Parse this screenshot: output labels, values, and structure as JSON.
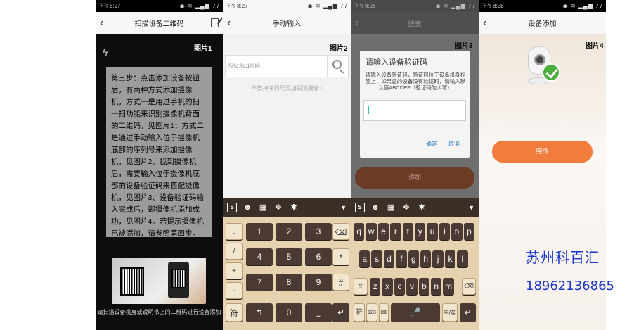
{
  "panel1": {
    "status_time": "下午8:27",
    "status_battery": "77",
    "title": "扫描设备二维码",
    "tag": "图片1",
    "step_text": "第三步：点击添加设备按钮后，有两种方式添加摄像机，方式一是用过手机的扫一扫功能来识别摄像机背面的二维码，见图片1；方式二是通过手动输入位于摄像机底部的序列号来添加摄像机，见图片2。找到摄像机后，需要输入位于摄像机底部的设备验证码来匹配摄像机，见图片3、设备验证码输入完成后，即摄像机添加成功，见图片4。若提示摄像机已被添加，请参照第四步。",
    "hint": "请扫描设备机身或说明书上的二维码进行设备添加"
  },
  "panel2": {
    "status_time": "下午8:27",
    "status_battery": "77",
    "title": "手动输入",
    "tag": "图片2",
    "serial_value": "584344899",
    "note": "不支持序列号添加探测摄像~"
  },
  "panel3": {
    "status_time": "下午8:28",
    "status_battery": "77",
    "title": "结果",
    "tag": "图片3",
    "dialog_title": "请输入设备验证码",
    "dialog_msg": "请输入设备验证码，验证码位于设备机身标签上，如果您的设备没有验证码，请输入默认值ABCDEF（验证码为大写）",
    "ok": "确定",
    "cancel": "取消",
    "add_button": "添加"
  },
  "panel4": {
    "status_time": "下午8:28",
    "status_battery": "77",
    "title": "设备添加",
    "tag": "图片4",
    "done_button": "完成"
  },
  "keyboard2": {
    "side": [
      ".",
      "/",
      "+",
      "-"
    ],
    "digits": [
      "1",
      "2",
      "3",
      "4",
      "5",
      "6",
      "7",
      "8",
      "9"
    ],
    "fn": [
      "⌫",
      "*",
      "#"
    ],
    "bottom": [
      "符",
      "0"
    ]
  },
  "keyboard3": {
    "row1": [
      "q",
      "w",
      "e",
      "r",
      "t",
      "y",
      "u",
      "i",
      "o",
      "p"
    ],
    "row2": [
      "a",
      "s",
      "d",
      "f",
      "g",
      "h",
      "j",
      "k",
      "l"
    ],
    "row3": [
      "z",
      "x",
      "c",
      "v",
      "b",
      "n",
      "m"
    ],
    "bottom": [
      "符",
      "123",
      "中",
      "英"
    ]
  },
  "brand": {
    "name": "苏州科百汇",
    "phone": "18962136865"
  }
}
